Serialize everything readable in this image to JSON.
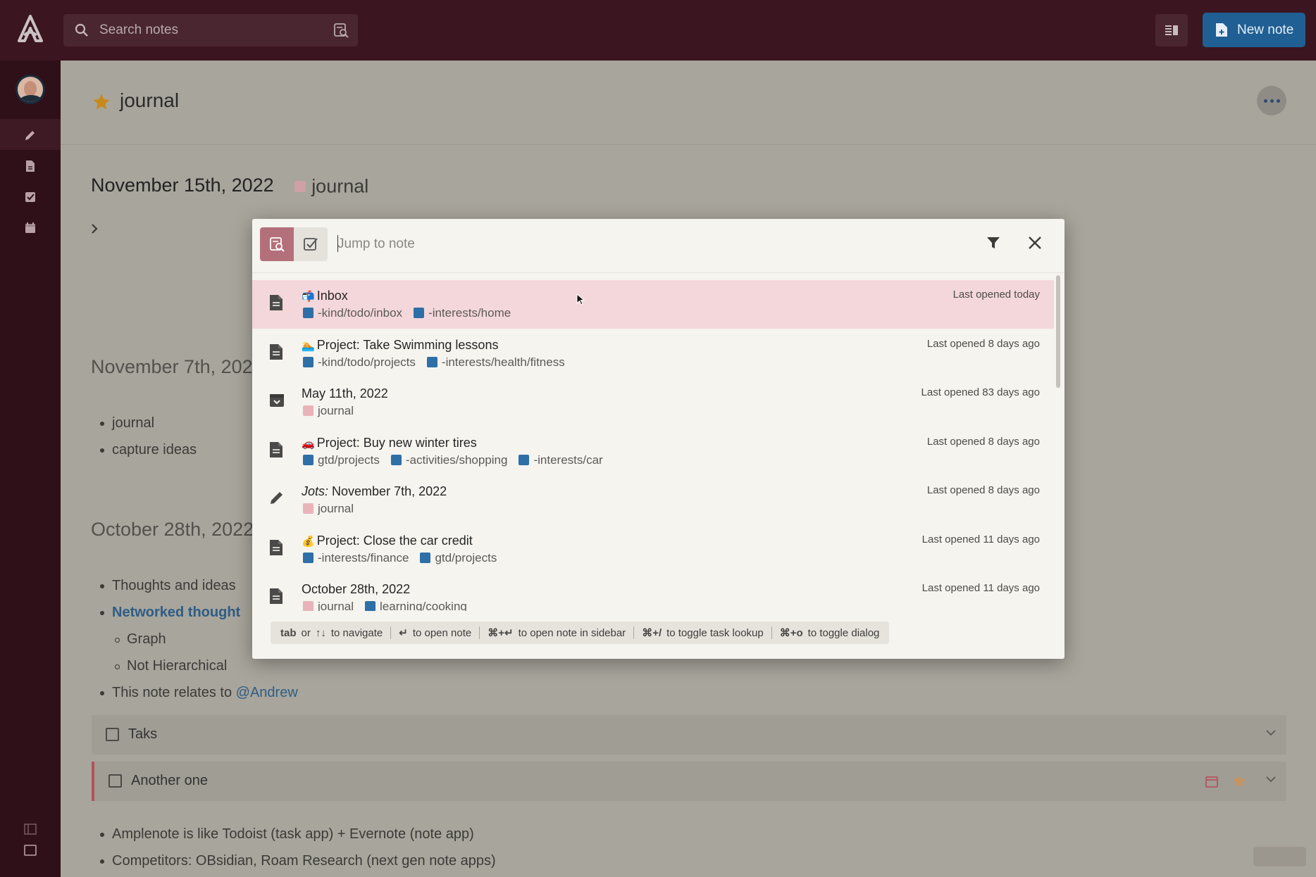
{
  "topbar": {
    "search_placeholder": "Search notes",
    "new_note_label": "New note"
  },
  "note": {
    "title": "journal"
  },
  "editor": {
    "section1": {
      "date": "November 15th, 2022",
      "tag": "journal"
    },
    "section2": {
      "date": "November 7th, 2022",
      "bullets": [
        "journal",
        "capture ideas"
      ]
    },
    "section3": {
      "date": "October 28th, 2022",
      "bullets": [
        "Thoughts and ideas",
        "Networked thought"
      ],
      "sub_bullets": [
        "Graph",
        "Not Hierarchical"
      ],
      "relates_text": "This note relates to",
      "mention": "@Andrew"
    },
    "tasks": [
      {
        "label": "Taks"
      },
      {
        "label": "Another one"
      }
    ],
    "footer_bullets": [
      "Amplenote is like Todoist (task app) + Evernote (note app)",
      "Competitors: OBsidian, Roam Research (next gen note apps)"
    ]
  },
  "dialog": {
    "input_placeholder": "Jump to note",
    "results": [
      {
        "icon": "document-icon",
        "emoji": "📬",
        "title": "Inbox",
        "title_prefix": "",
        "tags": [
          {
            "text": "-kind/todo/inbox",
            "color": "blue"
          },
          {
            "text": "-interests/home",
            "color": "blue"
          }
        ],
        "time": "Last opened today",
        "selected": true
      },
      {
        "icon": "document-icon",
        "emoji": "🏊",
        "title": "Project: Take Swimming lessons",
        "title_prefix": "",
        "tags": [
          {
            "text": "-kind/todo/projects",
            "color": "blue"
          },
          {
            "text": "-interests/health/fitness",
            "color": "blue"
          }
        ],
        "time": "Last opened 8 days ago",
        "selected": false
      },
      {
        "icon": "archive-icon",
        "emoji": "",
        "title": "May 11th, 2022",
        "title_prefix": "",
        "tags": [
          {
            "text": "journal",
            "color": "pink"
          }
        ],
        "time": "Last opened 83 days ago",
        "selected": false
      },
      {
        "icon": "document-icon",
        "emoji": "🚗",
        "title": "Project: Buy new winter tires",
        "title_prefix": "",
        "tags": [
          {
            "text": "gtd/projects",
            "color": "blue"
          },
          {
            "text": "-activities/shopping",
            "color": "blue"
          },
          {
            "text": "-interests/car",
            "color": "blue"
          }
        ],
        "time": "Last opened 8 days ago",
        "selected": false
      },
      {
        "icon": "pencil-icon",
        "emoji": "",
        "title": "November 7th, 2022",
        "title_prefix": "Jots:",
        "tags": [
          {
            "text": "journal",
            "color": "pink"
          }
        ],
        "time": "Last opened 8 days ago",
        "selected": false
      },
      {
        "icon": "document-icon",
        "emoji": "💰",
        "title": "Project: Close the car credit",
        "title_prefix": "",
        "tags": [
          {
            "text": "-interests/finance",
            "color": "blue"
          },
          {
            "text": "gtd/projects",
            "color": "blue"
          }
        ],
        "time": "Last opened 11 days ago",
        "selected": false
      },
      {
        "icon": "document-icon",
        "emoji": "",
        "title": "October 28th, 2022",
        "title_prefix": "",
        "tags": [
          {
            "text": "journal",
            "color": "pink"
          },
          {
            "text": "learning/cooking",
            "color": "blue"
          }
        ],
        "time": "Last opened 11 days ago",
        "selected": false
      }
    ],
    "hints": [
      {
        "keys": "tab",
        "text": "or",
        "keys2": "↑↓",
        "text2": "to navigate"
      },
      {
        "keys": "↵",
        "text": "to open note"
      },
      {
        "keys": "⌘+↵",
        "text": "to open note in sidebar"
      },
      {
        "keys": "⌘+/",
        "text": "to toggle task lookup"
      },
      {
        "keys": "⌘+o",
        "text": "to toggle dialog"
      }
    ]
  },
  "colors": {
    "topbar_bg": "#3b1520",
    "accent_blue": "#1f5f93",
    "selected_row": "#f4d7da",
    "mode_active": "#b4707a"
  }
}
